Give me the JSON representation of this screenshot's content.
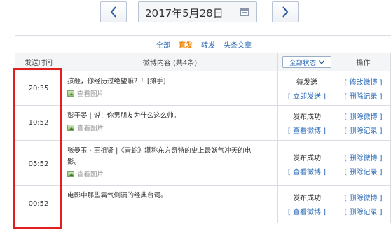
{
  "date_nav": {
    "date": "2017年5月28日",
    "prev_icon": "chevron-left-icon",
    "next_icon": "chevron-right-icon",
    "calendar_icon": "calendar-icon"
  },
  "filters": [
    {
      "label": "全部",
      "active": false
    },
    {
      "label": "直发",
      "active": true
    },
    {
      "label": "转发",
      "active": false
    },
    {
      "label": "头条文章",
      "active": false
    }
  ],
  "table": {
    "headers": {
      "time": "发送时间",
      "content": "微博内容 (共4条)",
      "status_select": "全部状态",
      "ops": "操作"
    },
    "rows": [
      {
        "time": "20:35",
        "text": "孩砸，你经历过绝望嘛？！[摊手]",
        "image_link": "查看图片",
        "status": "待发送",
        "status_action": "[ 立即发送 ]",
        "op1": "[ 修改微博 ]",
        "op2": "[ 删除记录 ]"
      },
      {
        "time": "10:52",
        "text": "彭于晏 | 说！你男朋友为什么这么帅。",
        "image_link": "查看图片",
        "status": "发布成功",
        "status_action": "[ 查看微博 ]",
        "op1": "[ 删除微博 ]",
        "op2": "[ 删除记录 ]"
      },
      {
        "time": "05:52",
        "text": "张曼玉 · 王祖贤 |《青蛇》堪称东方奇特的史上最妖气冲天的电影。",
        "image_link": "查看图片",
        "status": "发布成功",
        "status_action": "[ 查看微博 ]",
        "op1": "[ 删除微博 ]",
        "op2": "[ 删除记录 ]"
      },
      {
        "time": "00:52",
        "text": "电影中那些霸气侧漏的经典台词。",
        "image_link": "",
        "status": "发布成功",
        "status_action": "[ 查看微博 ]",
        "op1": "[ 删除微博 ]",
        "op2": "[ 删除记录 ]"
      }
    ]
  },
  "colors": {
    "link": "#2b6bb8",
    "active_filter": "#f08200",
    "highlight_border": "#e02020"
  }
}
